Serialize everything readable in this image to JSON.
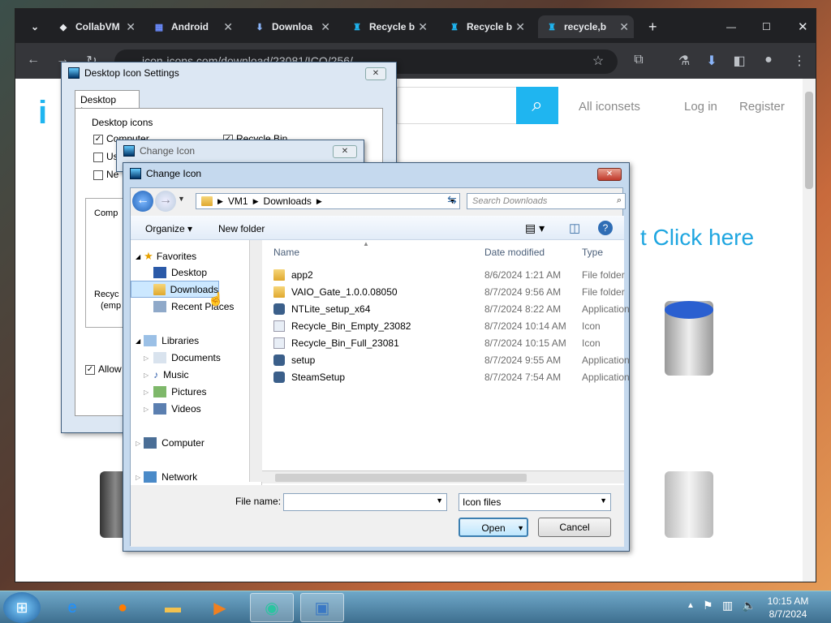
{
  "browser": {
    "tabs": [
      {
        "label": "CollabVM",
        "icon": "collabvm-icon"
      },
      {
        "label": "Android",
        "icon": "android-icon"
      },
      {
        "label": "Downloa",
        "icon": "download-icon"
      },
      {
        "label": "Recycle b",
        "icon": "iconsets-icon"
      },
      {
        "label": "Recycle b",
        "icon": "iconsets-icon"
      },
      {
        "label": "recycle,b",
        "icon": "iconsets-icon"
      }
    ],
    "url": "icon-icons.com/download/23081/ICO/256/",
    "page": {
      "nav": [
        "All iconsets",
        "Log in",
        "Register"
      ],
      "click_here": "t Click here"
    }
  },
  "desktop_icon_settings": {
    "title": "Desktop Icon Settings",
    "tab": "Desktop Icons",
    "group": "Desktop icons",
    "checkboxes": [
      {
        "label": "Computer",
        "checked": true
      },
      {
        "label": "Recycle Bin",
        "checked": true
      },
      {
        "label": "Us",
        "checked": false
      },
      {
        "label": "Ne",
        "checked": false
      }
    ],
    "icon_labels": [
      "Comp",
      "Recyc",
      "(emp"
    ],
    "allow_label": "Allow"
  },
  "change_icon_back": {
    "title": "Change Icon"
  },
  "change_icon": {
    "title": "Change Icon",
    "breadcrumb": [
      "VM1",
      "Downloads"
    ],
    "search_placeholder": "Search Downloads",
    "organize": "Organize ▾",
    "new_folder": "New folder",
    "nav": {
      "favorites": "Favorites",
      "desktop": "Desktop",
      "downloads": "Downloads",
      "recent": "Recent Places",
      "libraries": "Libraries",
      "documents": "Documents",
      "music": "Music",
      "pictures": "Pictures",
      "videos": "Videos",
      "computer": "Computer",
      "network": "Network"
    },
    "columns": {
      "name": "Name",
      "date": "Date modified",
      "type": "Type"
    },
    "files": [
      {
        "name": "app2",
        "date": "8/6/2024 1:21 AM",
        "type": "File folder",
        "kind": "folder"
      },
      {
        "name": "VAIO_Gate_1.0.0.08050",
        "date": "8/7/2024 9:56 AM",
        "type": "File folder",
        "kind": "folder"
      },
      {
        "name": "NTLite_setup_x64",
        "date": "8/7/2024 8:22 AM",
        "type": "Application",
        "kind": "app"
      },
      {
        "name": "Recycle_Bin_Empty_23082",
        "date": "8/7/2024 10:14 AM",
        "type": "Icon",
        "kind": "icon"
      },
      {
        "name": "Recycle_Bin_Full_23081",
        "date": "8/7/2024 10:15 AM",
        "type": "Icon",
        "kind": "icon"
      },
      {
        "name": "setup",
        "date": "8/7/2024 9:55 AM",
        "type": "Application",
        "kind": "app"
      },
      {
        "name": "SteamSetup",
        "date": "8/7/2024 7:54 AM",
        "type": "Application",
        "kind": "app"
      }
    ],
    "file_name_label": "File name:",
    "file_name_value": "",
    "file_type": "Icon files",
    "open": "Open",
    "cancel": "Cancel"
  },
  "taskbar": {
    "time": "10:15 AM",
    "date": "8/7/2024"
  }
}
